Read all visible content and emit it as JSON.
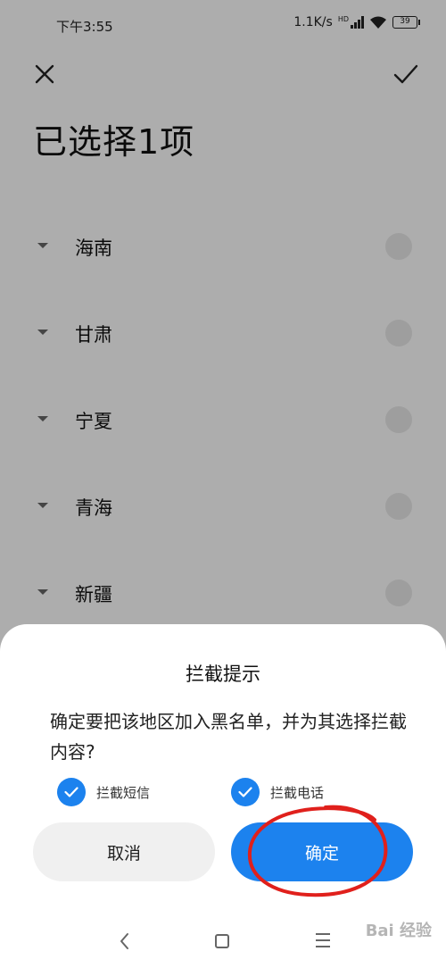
{
  "status_bar": {
    "time": "下午3:55",
    "network_speed": "1.1K/s",
    "network_badge": "HD",
    "battery": "39"
  },
  "header": {
    "title": "已选择1项",
    "close_icon": "close-icon",
    "confirm_icon": "check-icon"
  },
  "regions": [
    {
      "name": "海南",
      "selected": false
    },
    {
      "name": "甘肃",
      "selected": false
    },
    {
      "name": "宁夏",
      "selected": false
    },
    {
      "name": "青海",
      "selected": false
    },
    {
      "name": "新疆",
      "selected": false
    }
  ],
  "dialog": {
    "title": "拦截提示",
    "message": "确定要把该地区加入黑名单，并为其选择拦截内容?",
    "options": [
      {
        "label": "拦截短信",
        "checked": true
      },
      {
        "label": "拦截电话",
        "checked": true
      }
    ],
    "cancel_label": "取消",
    "confirm_label": "确定"
  },
  "colors": {
    "accent": "#1c82ee",
    "annotation": "#e0201c"
  },
  "watermark": {
    "text": "Bai 经验"
  }
}
